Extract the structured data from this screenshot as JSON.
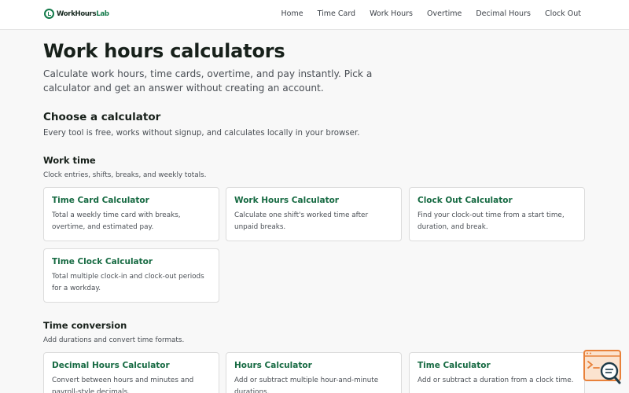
{
  "brand": {
    "name_part1": "WorkHours",
    "name_part2": "Lab"
  },
  "nav": [
    "Home",
    "Time Card",
    "Work Hours",
    "Overtime",
    "Decimal Hours",
    "Clock Out"
  ],
  "hero": {
    "title": "Work hours calculators",
    "lead": "Calculate work hours, time cards, overtime, and pay instantly. Pick a calculator and get an answer without creating an account."
  },
  "section": {
    "title": "Choose a calculator",
    "subtitle": "Every tool is free, works without signup, and calculates locally in your browser."
  },
  "groups": [
    {
      "title": "Work time",
      "description": "Clock entries, shifts, breaks, and weekly totals.",
      "cards": [
        {
          "title": "Time Card Calculator",
          "description": "Total a weekly time card with breaks, overtime, and estimated pay."
        },
        {
          "title": "Work Hours Calculator",
          "description": "Calculate one shift's worked time after unpaid breaks."
        },
        {
          "title": "Clock Out Calculator",
          "description": "Find your clock-out time from a start time, duration, and break."
        },
        {
          "title": "Time Clock Calculator",
          "description": "Total multiple clock-in and clock-out periods for a workday."
        }
      ]
    },
    {
      "title": "Time conversion",
      "description": "Add durations and convert time formats.",
      "cards": [
        {
          "title": "Decimal Hours Calculator",
          "description": "Convert between hours and minutes and payroll-style decimals."
        },
        {
          "title": "Hours Calculator",
          "description": "Add or subtract multiple hour-and-minute durations."
        },
        {
          "title": "Time Calculator",
          "description": "Add or subtract a duration from a clock time."
        }
      ]
    }
  ],
  "colors": {
    "accent": "#166a42",
    "chat_widget": "#e8813a"
  },
  "icons": {
    "logo": "clock-check-icon",
    "chat": "chat-search-icon"
  }
}
